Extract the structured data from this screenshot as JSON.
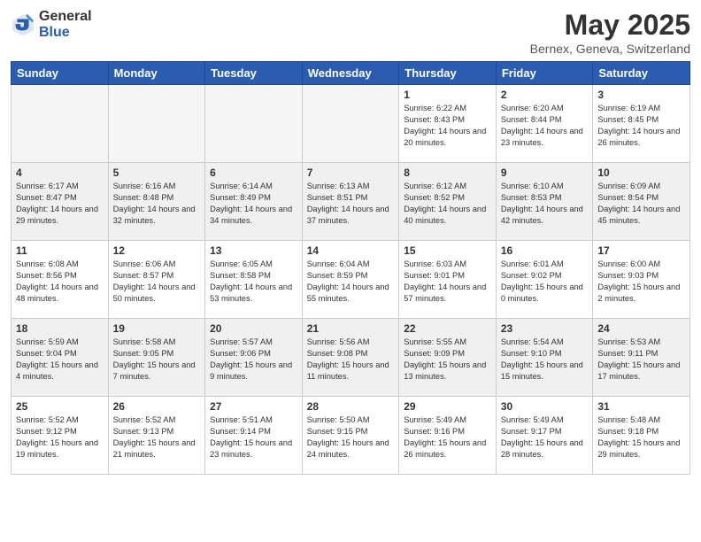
{
  "logo": {
    "general": "General",
    "blue": "Blue"
  },
  "title": "May 2025",
  "subtitle": "Bernex, Geneva, Switzerland",
  "days_of_week": [
    "Sunday",
    "Monday",
    "Tuesday",
    "Wednesday",
    "Thursday",
    "Friday",
    "Saturday"
  ],
  "weeks": [
    [
      {
        "day": "",
        "sunrise": "",
        "sunset": "",
        "daylight": "",
        "empty": true
      },
      {
        "day": "",
        "sunrise": "",
        "sunset": "",
        "daylight": "",
        "empty": true
      },
      {
        "day": "",
        "sunrise": "",
        "sunset": "",
        "daylight": "",
        "empty": true
      },
      {
        "day": "",
        "sunrise": "",
        "sunset": "",
        "daylight": "",
        "empty": true
      },
      {
        "day": "1",
        "sunrise": "Sunrise: 6:22 AM",
        "sunset": "Sunset: 8:43 PM",
        "daylight": "Daylight: 14 hours and 20 minutes.",
        "empty": false
      },
      {
        "day": "2",
        "sunrise": "Sunrise: 6:20 AM",
        "sunset": "Sunset: 8:44 PM",
        "daylight": "Daylight: 14 hours and 23 minutes.",
        "empty": false
      },
      {
        "day": "3",
        "sunrise": "Sunrise: 6:19 AM",
        "sunset": "Sunset: 8:45 PM",
        "daylight": "Daylight: 14 hours and 26 minutes.",
        "empty": false
      }
    ],
    [
      {
        "day": "4",
        "sunrise": "Sunrise: 6:17 AM",
        "sunset": "Sunset: 8:47 PM",
        "daylight": "Daylight: 14 hours and 29 minutes.",
        "empty": false
      },
      {
        "day": "5",
        "sunrise": "Sunrise: 6:16 AM",
        "sunset": "Sunset: 8:48 PM",
        "daylight": "Daylight: 14 hours and 32 minutes.",
        "empty": false
      },
      {
        "day": "6",
        "sunrise": "Sunrise: 6:14 AM",
        "sunset": "Sunset: 8:49 PM",
        "daylight": "Daylight: 14 hours and 34 minutes.",
        "empty": false
      },
      {
        "day": "7",
        "sunrise": "Sunrise: 6:13 AM",
        "sunset": "Sunset: 8:51 PM",
        "daylight": "Daylight: 14 hours and 37 minutes.",
        "empty": false
      },
      {
        "day": "8",
        "sunrise": "Sunrise: 6:12 AM",
        "sunset": "Sunset: 8:52 PM",
        "daylight": "Daylight: 14 hours and 40 minutes.",
        "empty": false
      },
      {
        "day": "9",
        "sunrise": "Sunrise: 6:10 AM",
        "sunset": "Sunset: 8:53 PM",
        "daylight": "Daylight: 14 hours and 42 minutes.",
        "empty": false
      },
      {
        "day": "10",
        "sunrise": "Sunrise: 6:09 AM",
        "sunset": "Sunset: 8:54 PM",
        "daylight": "Daylight: 14 hours and 45 minutes.",
        "empty": false
      }
    ],
    [
      {
        "day": "11",
        "sunrise": "Sunrise: 6:08 AM",
        "sunset": "Sunset: 8:56 PM",
        "daylight": "Daylight: 14 hours and 48 minutes.",
        "empty": false
      },
      {
        "day": "12",
        "sunrise": "Sunrise: 6:06 AM",
        "sunset": "Sunset: 8:57 PM",
        "daylight": "Daylight: 14 hours and 50 minutes.",
        "empty": false
      },
      {
        "day": "13",
        "sunrise": "Sunrise: 6:05 AM",
        "sunset": "Sunset: 8:58 PM",
        "daylight": "Daylight: 14 hours and 53 minutes.",
        "empty": false
      },
      {
        "day": "14",
        "sunrise": "Sunrise: 6:04 AM",
        "sunset": "Sunset: 8:59 PM",
        "daylight": "Daylight: 14 hours and 55 minutes.",
        "empty": false
      },
      {
        "day": "15",
        "sunrise": "Sunrise: 6:03 AM",
        "sunset": "Sunset: 9:01 PM",
        "daylight": "Daylight: 14 hours and 57 minutes.",
        "empty": false
      },
      {
        "day": "16",
        "sunrise": "Sunrise: 6:01 AM",
        "sunset": "Sunset: 9:02 PM",
        "daylight": "Daylight: 15 hours and 0 minutes.",
        "empty": false
      },
      {
        "day": "17",
        "sunrise": "Sunrise: 6:00 AM",
        "sunset": "Sunset: 9:03 PM",
        "daylight": "Daylight: 15 hours and 2 minutes.",
        "empty": false
      }
    ],
    [
      {
        "day": "18",
        "sunrise": "Sunrise: 5:59 AM",
        "sunset": "Sunset: 9:04 PM",
        "daylight": "Daylight: 15 hours and 4 minutes.",
        "empty": false
      },
      {
        "day": "19",
        "sunrise": "Sunrise: 5:58 AM",
        "sunset": "Sunset: 9:05 PM",
        "daylight": "Daylight: 15 hours and 7 minutes.",
        "empty": false
      },
      {
        "day": "20",
        "sunrise": "Sunrise: 5:57 AM",
        "sunset": "Sunset: 9:06 PM",
        "daylight": "Daylight: 15 hours and 9 minutes.",
        "empty": false
      },
      {
        "day": "21",
        "sunrise": "Sunrise: 5:56 AM",
        "sunset": "Sunset: 9:08 PM",
        "daylight": "Daylight: 15 hours and 11 minutes.",
        "empty": false
      },
      {
        "day": "22",
        "sunrise": "Sunrise: 5:55 AM",
        "sunset": "Sunset: 9:09 PM",
        "daylight": "Daylight: 15 hours and 13 minutes.",
        "empty": false
      },
      {
        "day": "23",
        "sunrise": "Sunrise: 5:54 AM",
        "sunset": "Sunset: 9:10 PM",
        "daylight": "Daylight: 15 hours and 15 minutes.",
        "empty": false
      },
      {
        "day": "24",
        "sunrise": "Sunrise: 5:53 AM",
        "sunset": "Sunset: 9:11 PM",
        "daylight": "Daylight: 15 hours and 17 minutes.",
        "empty": false
      }
    ],
    [
      {
        "day": "25",
        "sunrise": "Sunrise: 5:52 AM",
        "sunset": "Sunset: 9:12 PM",
        "daylight": "Daylight: 15 hours and 19 minutes.",
        "empty": false
      },
      {
        "day": "26",
        "sunrise": "Sunrise: 5:52 AM",
        "sunset": "Sunset: 9:13 PM",
        "daylight": "Daylight: 15 hours and 21 minutes.",
        "empty": false
      },
      {
        "day": "27",
        "sunrise": "Sunrise: 5:51 AM",
        "sunset": "Sunset: 9:14 PM",
        "daylight": "Daylight: 15 hours and 23 minutes.",
        "empty": false
      },
      {
        "day": "28",
        "sunrise": "Sunrise: 5:50 AM",
        "sunset": "Sunset: 9:15 PM",
        "daylight": "Daylight: 15 hours and 24 minutes.",
        "empty": false
      },
      {
        "day": "29",
        "sunrise": "Sunrise: 5:49 AM",
        "sunset": "Sunset: 9:16 PM",
        "daylight": "Daylight: 15 hours and 26 minutes.",
        "empty": false
      },
      {
        "day": "30",
        "sunrise": "Sunrise: 5:49 AM",
        "sunset": "Sunset: 9:17 PM",
        "daylight": "Daylight: 15 hours and 28 minutes.",
        "empty": false
      },
      {
        "day": "31",
        "sunrise": "Sunrise: 5:48 AM",
        "sunset": "Sunset: 9:18 PM",
        "daylight": "Daylight: 15 hours and 29 minutes.",
        "empty": false
      }
    ]
  ]
}
